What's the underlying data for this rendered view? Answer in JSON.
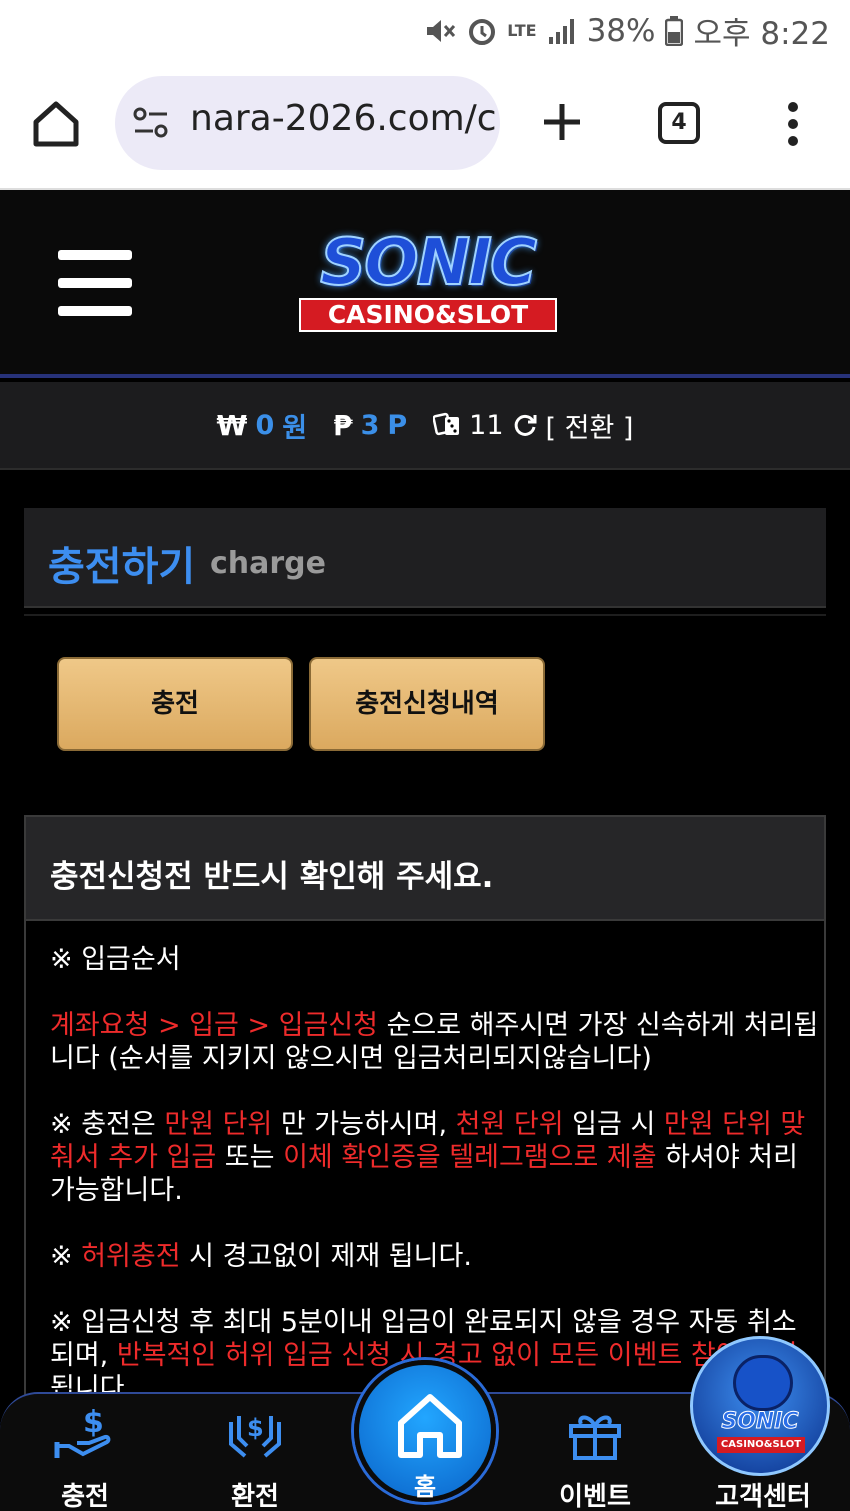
{
  "status_bar": {
    "icons": [
      "mute-icon",
      "alarm-icon",
      "lte-icon",
      "signal-icon",
      "battery-icon"
    ],
    "lte": "LTE",
    "battery": "38%",
    "time": "오후 8:22"
  },
  "browser": {
    "url": "nara-2026.com/c",
    "tab_count": "4"
  },
  "header": {
    "logo_main": "SONIC",
    "logo_sub": "CASINO&SLOT"
  },
  "balance": {
    "money_symbol": "₩",
    "money_value": "0",
    "money_unit": "원",
    "point_symbol": "₱",
    "point_value": "3",
    "point_unit": "P",
    "chip_value": "11",
    "switch_label": "[ 전환 ]"
  },
  "section": {
    "title_ko": "충전하기",
    "title_en": "charge"
  },
  "buttons": {
    "charge": "충전",
    "history": "충전신청내역"
  },
  "notice": {
    "heading": "충전신청전 반드시 확인해 주세요.",
    "p1": "※ 입금순서",
    "p2_red": "계좌요청 > 입금 > 입금신청",
    "p2_text": " 순으로 해주시면 가장 신속하게 처리됩니다 (순서를 지키지 않으시면 입금처리되지않습니다)",
    "p3_a": "※ 충전은 ",
    "p3_red1": "만원 단위",
    "p3_b": " 만 가능하시며, ",
    "p3_red2": "천원 단위",
    "p3_c": " 입금 시 ",
    "p3_red3": "만원 단위 맞춰서 추가 입금",
    "p3_d": " 또는 ",
    "p3_red4": "이체 확인증을 텔레그램으로 제출",
    "p3_e": " 하셔야 처리 가능합니다.",
    "p4_a": "※ ",
    "p4_red": "허위충전",
    "p4_b": " 시 경고없이 제재 됩니다.",
    "p5_a": "※ 입금신청 후 최대 5분이내 입금이 완료되지 않을 경우 자동 취소 되며, ",
    "p5_red": "반복적인 허위 입금 신청 시 경고 없이 모든 이벤트 참여 불가",
    "p5_b": " 됩니다."
  },
  "bottom_nav": {
    "charge": "충전",
    "exchange": "환전",
    "home": "홈",
    "event": "이벤트",
    "support": "고객센터"
  },
  "colors": {
    "accent_blue": "#3d8ef0",
    "warning_red": "#ee2b2b",
    "button_gold": "#e3b56e"
  }
}
